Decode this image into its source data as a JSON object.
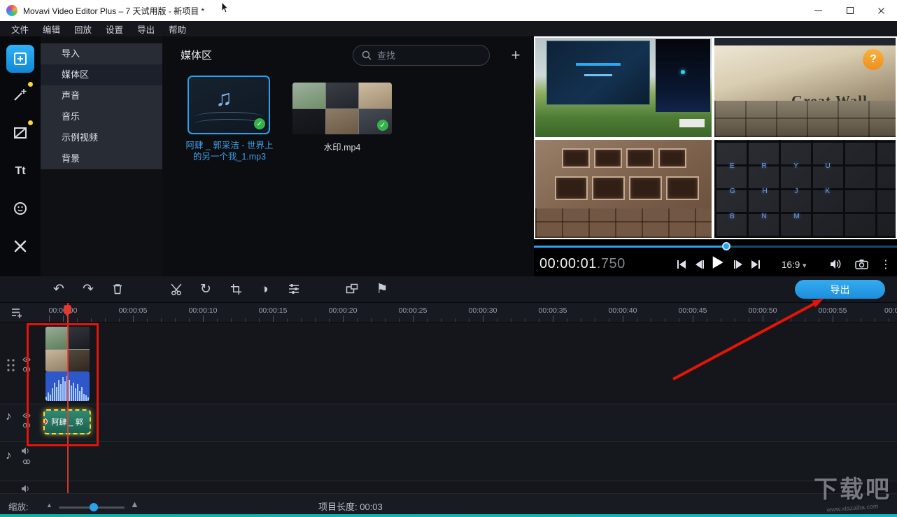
{
  "window": {
    "title": "Movavi Video Editor Plus – 7 天试用版 - 新项目 *"
  },
  "menu": {
    "items": [
      "文件",
      "编辑",
      "回放",
      "设置",
      "导出",
      "帮助"
    ]
  },
  "icons": {
    "titles": "Tt",
    "check": "✓",
    "undo": "↶",
    "redo": "↷",
    "rotate": "↻",
    "contrast": "◑",
    "flag": "⚑",
    "dots": "⋮",
    "caret_down": "▾",
    "music_note": "♫",
    "music_note_small": "♪",
    "plus": "+",
    "help": "?",
    "zoom_out": "▲",
    "zoom_in": "▲"
  },
  "sidebar": {
    "items": [
      {
        "label": "导入"
      },
      {
        "label": "媒体区"
      },
      {
        "label": "声音"
      },
      {
        "label": "音乐"
      },
      {
        "label": "示例视频"
      },
      {
        "label": "背景"
      }
    ]
  },
  "media_panel": {
    "title": "媒体区",
    "search_placeholder": "查找",
    "items": [
      {
        "caption_line1": "阿肆 _ 郭采洁 - 世界上",
        "caption_line2": "的另一个我_1.mp3"
      },
      {
        "caption": "水印.mp4"
      }
    ]
  },
  "preview": {
    "overlay_text": "Great Wall",
    "keyboard_rows": [
      "E R Y U",
      "G H J K",
      "B N M"
    ],
    "timecode": "00:00:01",
    "timecode_ms": ".750",
    "aspect_ratio": "16:9"
  },
  "timeline": {
    "export_label": "导出",
    "ruler_labels": [
      "00:00:00",
      "00:00:05",
      "00:00:10",
      "00:00:15",
      "00:00:20",
      "00:00:25",
      "00:00:30",
      "00:00:35",
      "00:00:40",
      "00:00:45",
      "00:00:50",
      "00:00:55",
      "00:0"
    ],
    "audio_clip_label": "阿肆 _ 郭"
  },
  "status_bar": {
    "zoom_label": "缩放:",
    "project_length": "项目长度: 00:03"
  },
  "watermark": {
    "text": "下载吧",
    "sub": "www.xiazaiba.com"
  },
  "colors": {
    "accent_blue": "#2ba2ef",
    "export_blue": "#2aa0ea",
    "annotation_red": "#e51407",
    "badge_yellow": "#ffd43c",
    "check_green": "#35b34a",
    "selection_yellow": "#ffd83d"
  }
}
